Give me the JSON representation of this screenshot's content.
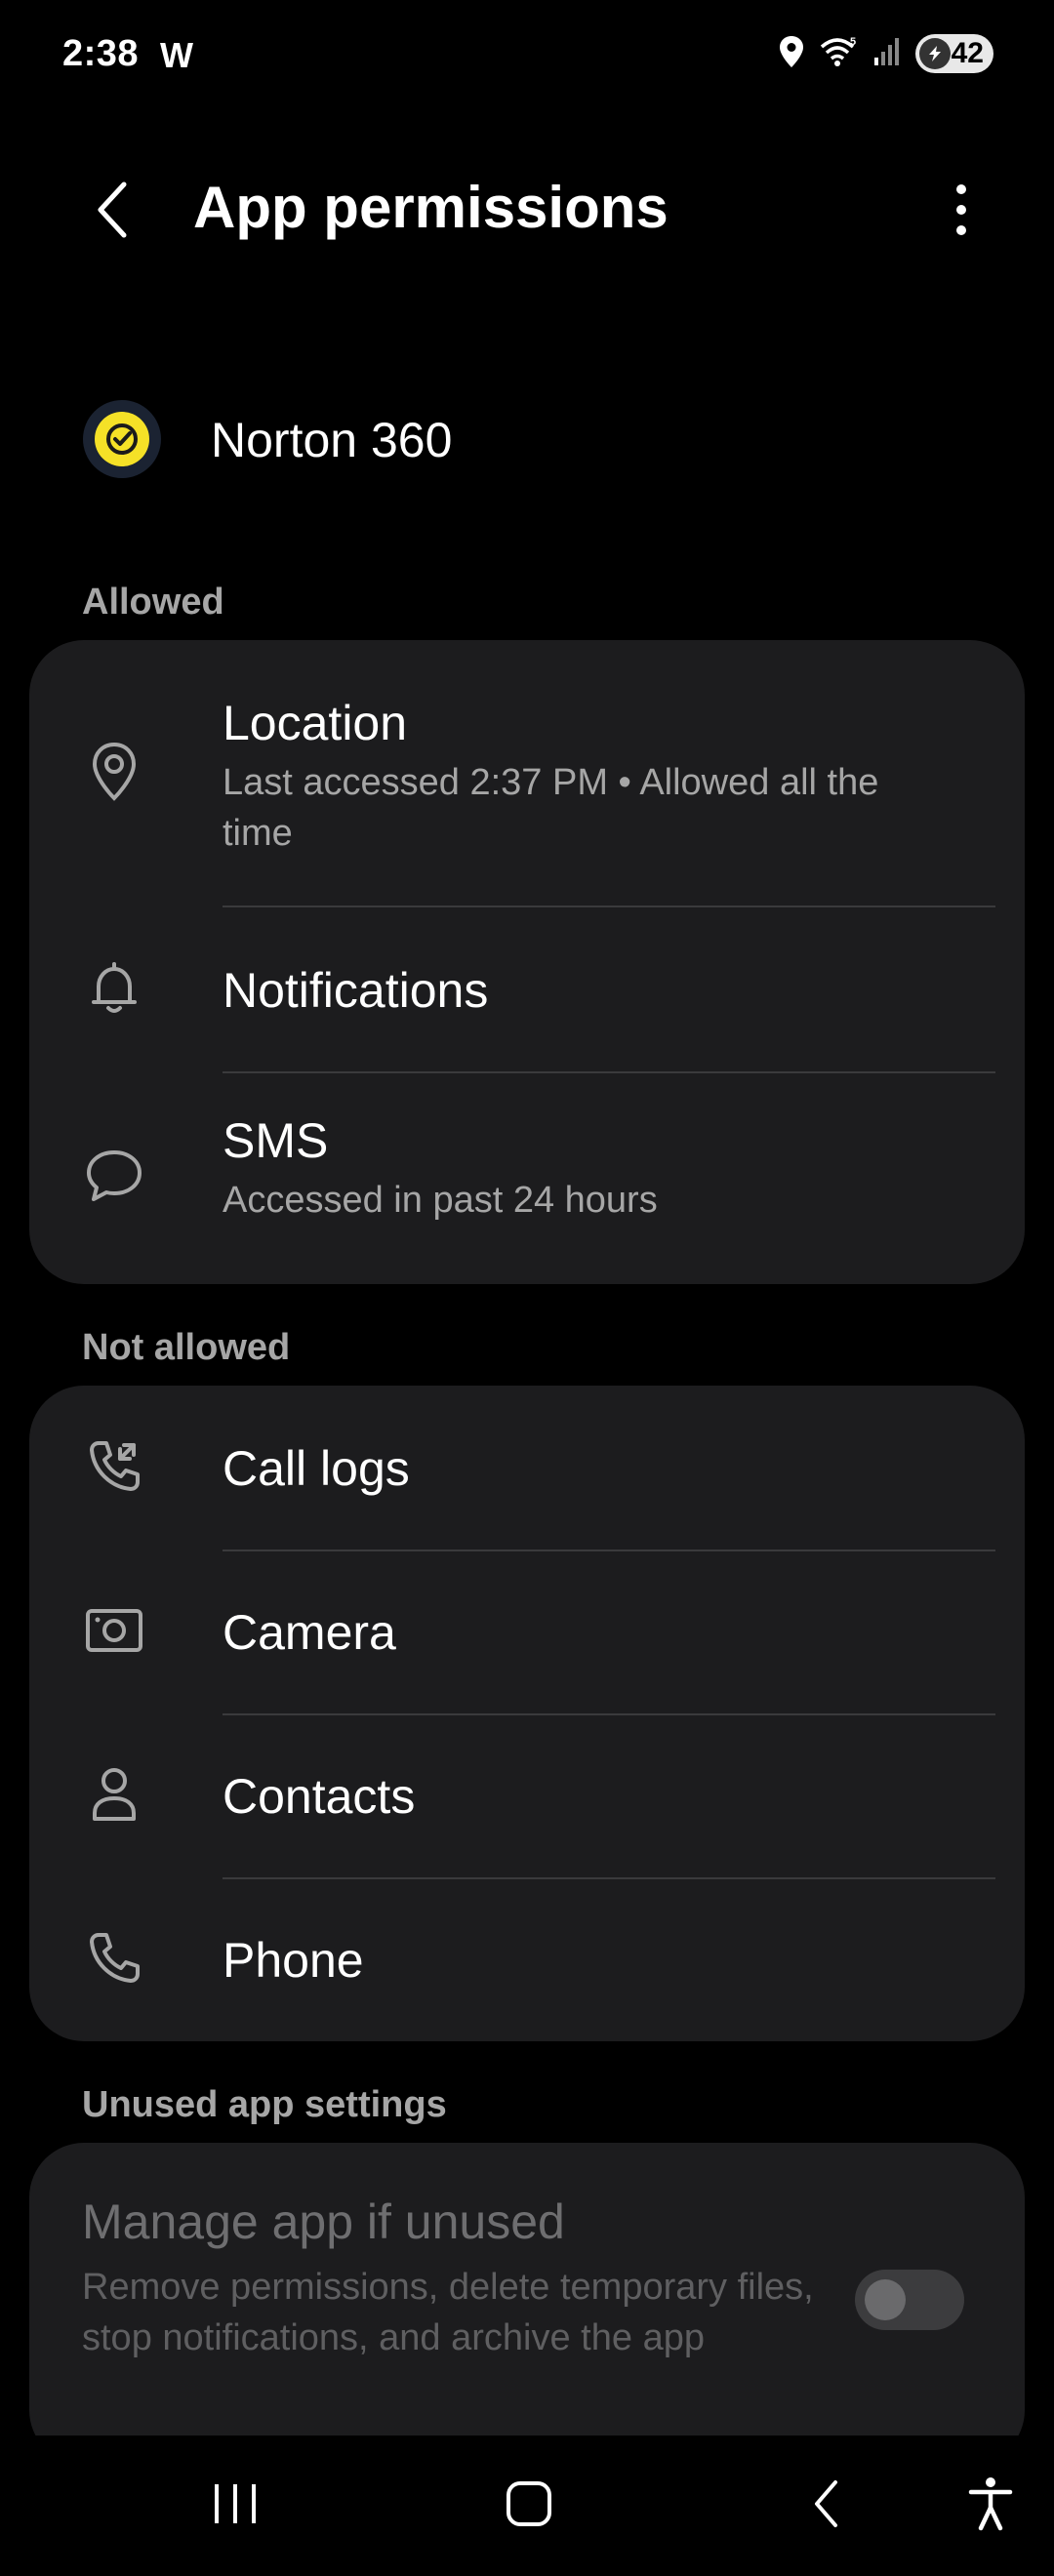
{
  "status_bar": {
    "time": "2:38",
    "carrier_glyph": "W",
    "battery": "42",
    "icons": [
      "location-icon",
      "wifi-icon",
      "signal-icon",
      "battery-icon"
    ]
  },
  "header": {
    "title": "App permissions"
  },
  "app": {
    "name": "Norton 360",
    "icon": "norton-icon",
    "brand_color": "#f5e127"
  },
  "sections": {
    "allowed_label": "Allowed",
    "not_allowed_label": "Not allowed",
    "unused_label": "Unused app settings"
  },
  "allowed": [
    {
      "title": "Location",
      "subtitle": "Last accessed 2:37 PM • Allowed all the time",
      "icon": "location-pin-icon"
    },
    {
      "title": "Notifications",
      "subtitle": "",
      "icon": "bell-icon"
    },
    {
      "title": "SMS",
      "subtitle": "Accessed in past 24 hours",
      "icon": "chat-bubble-icon"
    }
  ],
  "not_allowed": [
    {
      "title": "Call logs",
      "icon": "call-log-icon"
    },
    {
      "title": "Camera",
      "icon": "camera-icon"
    },
    {
      "title": "Contacts",
      "icon": "person-icon"
    },
    {
      "title": "Phone",
      "icon": "phone-icon"
    }
  ],
  "unused": {
    "title": "Manage app if unused",
    "subtitle": "Remove permissions, delete temporary files, stop notifications, and archive the app",
    "toggle_on": false
  },
  "nav": {
    "icons": [
      "recents-icon",
      "home-icon",
      "back-icon",
      "accessibility-icon"
    ]
  }
}
